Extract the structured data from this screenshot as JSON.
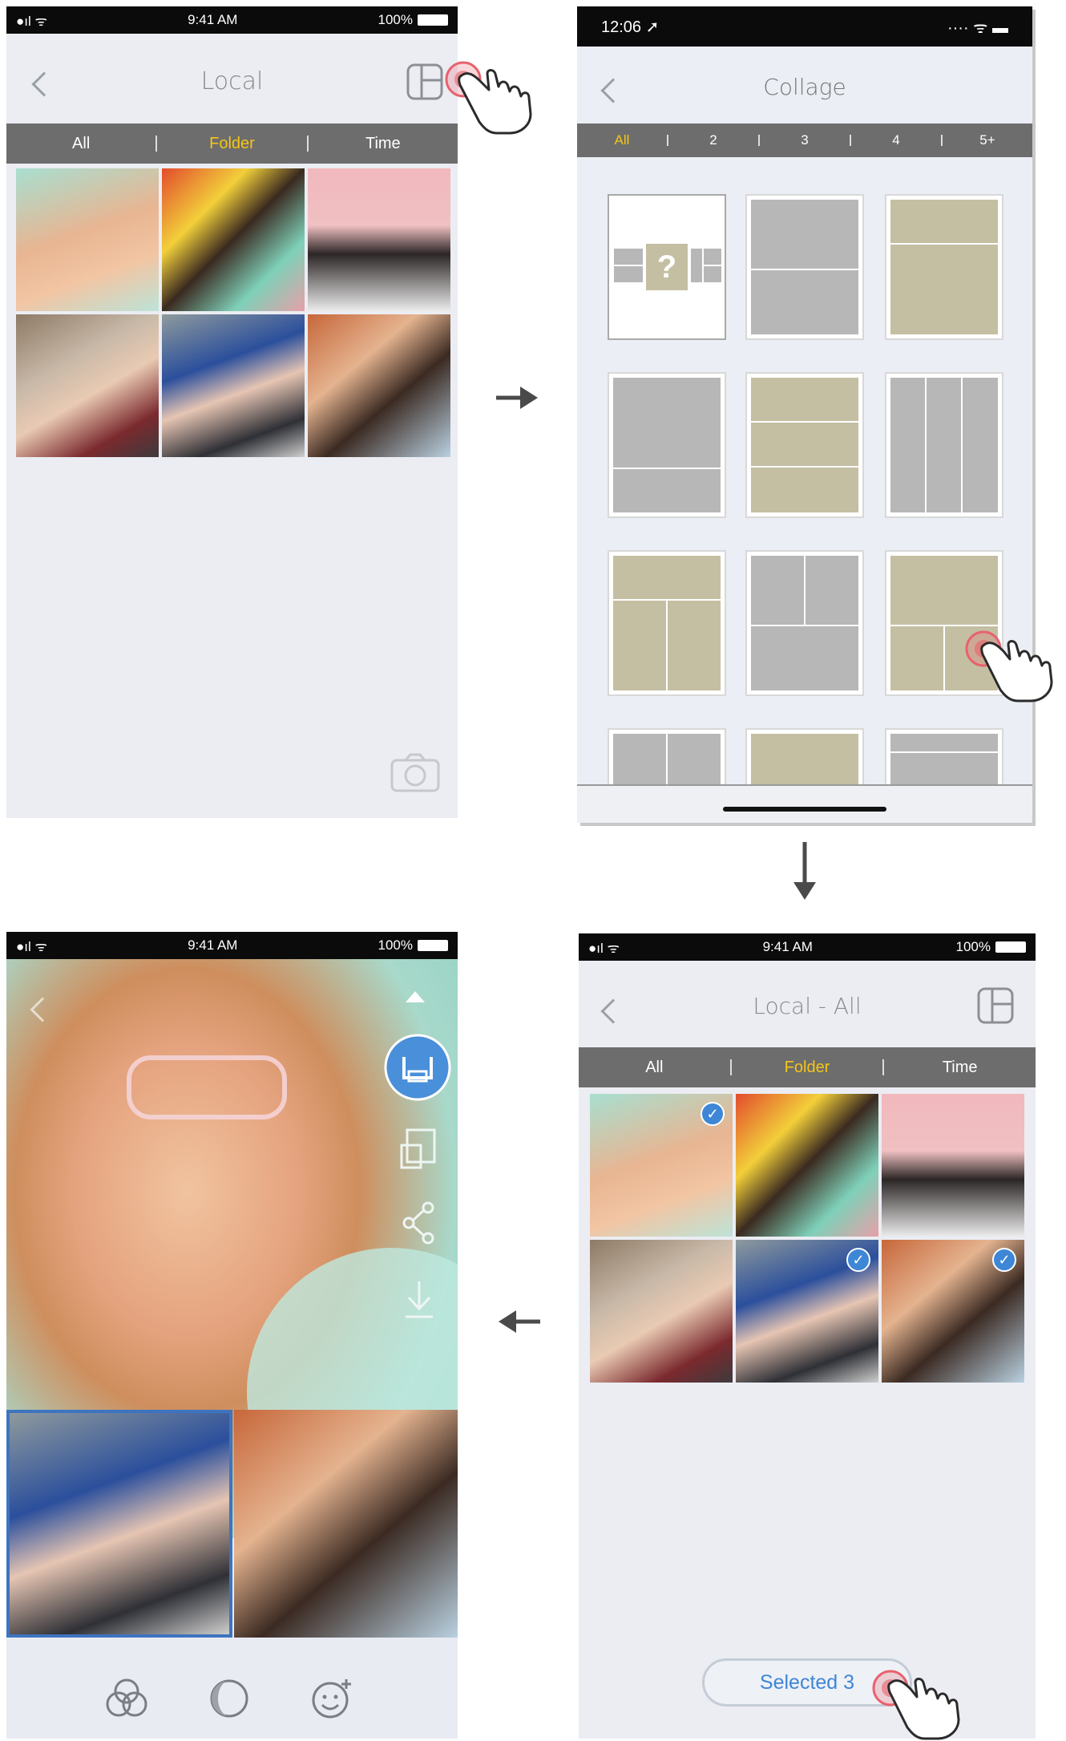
{
  "screen1": {
    "status": {
      "signal": "●ıl ᯤ",
      "time": "9:41 AM",
      "battery": "100%"
    },
    "title": "Local",
    "tabs": [
      {
        "label": "All"
      },
      {
        "label": "Folder"
      },
      {
        "label": "Time"
      }
    ]
  },
  "screen2": {
    "status": {
      "time": "12:06 ➚",
      "icons": "···· ᯤ ▬"
    },
    "title": "Collage",
    "filters": [
      {
        "label": "All"
      },
      {
        "label": "2"
      },
      {
        "label": "3"
      },
      {
        "label": "4"
      },
      {
        "label": "5+"
      }
    ],
    "placeholder_mark": "?"
  },
  "screen3": {
    "status": {
      "signal": "●ıl ᯤ",
      "time": "9:41 AM",
      "battery": "100%"
    },
    "title": "Local - All",
    "tabs": [
      {
        "label": "All"
      },
      {
        "label": "Folder"
      },
      {
        "label": "Time"
      }
    ],
    "selected_button": "Selected 3",
    "checkmark": "✓"
  },
  "screen4": {
    "status": {
      "signal": "●ıl ᯤ",
      "time": "9:41 AM",
      "battery": "100%"
    }
  },
  "colors": {
    "accent_yellow": "#f5c518",
    "tab_bar": "#6d6d6d",
    "selection_blue": "#3e86d6",
    "tap_ring": "#e8626e"
  }
}
